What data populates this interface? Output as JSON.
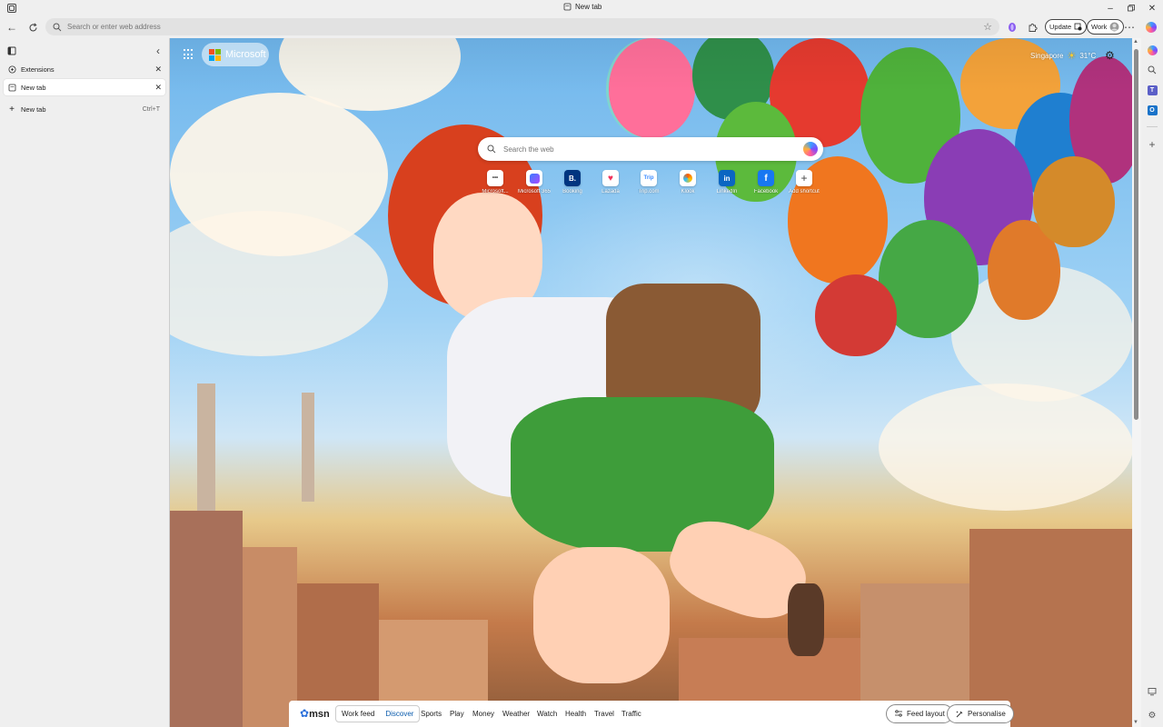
{
  "window": {
    "title": "New tab"
  },
  "toolbar": {
    "address_placeholder": "Search or enter web address",
    "update_label": "Update",
    "profile_label": "Work"
  },
  "vertical_tabs": {
    "items": [
      {
        "label": "Extensions",
        "active": false
      },
      {
        "label": "New tab",
        "active": true
      }
    ],
    "new_tab_label": "New tab",
    "new_tab_shortcut": "Ctrl+T"
  },
  "newtab": {
    "brand": "Microsoft",
    "weather": {
      "location": "Singapore",
      "temperature": "31°C"
    },
    "search_placeholder": "Search the web",
    "shortcuts": [
      {
        "label": "Microsoft...",
        "icon": "microsoft-icon"
      },
      {
        "label": "Microsoft 365",
        "icon": "m365-icon"
      },
      {
        "label": "Booking",
        "icon": "booking-icon"
      },
      {
        "label": "Lazada",
        "icon": "lazada-icon"
      },
      {
        "label": "Trip.com",
        "icon": "trip-icon"
      },
      {
        "label": "Klook",
        "icon": "klook-icon"
      },
      {
        "label": "LinkedIn",
        "icon": "linkedin-icon"
      },
      {
        "label": "Facebook",
        "icon": "facebook-icon"
      },
      {
        "label": "Add shortcut",
        "icon": "plus-icon"
      }
    ]
  },
  "msn": {
    "logo": "msn",
    "feed_tabs": [
      "Work feed",
      "Discover"
    ],
    "active_feed": "Discover",
    "links": [
      "Sports",
      "Play",
      "Money",
      "Weather",
      "Watch",
      "Health",
      "Travel",
      "Traffic"
    ],
    "feed_layout_label": "Feed layout",
    "personalise_label": "Personalise"
  },
  "colors": {
    "accent": "#0b5cad",
    "linkedin": "#0a66c2",
    "facebook": "#1877f2",
    "booking": "#003580",
    "lazada": "#f0325b"
  }
}
